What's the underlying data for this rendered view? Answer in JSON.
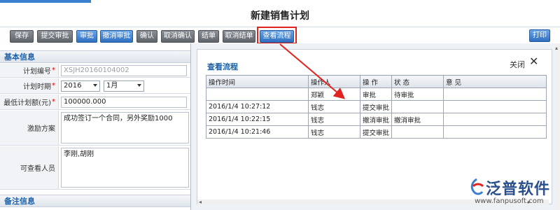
{
  "page_title": "新建销售计划",
  "toolbar": {
    "buttons": [
      {
        "label": "保存",
        "style": "gray"
      },
      {
        "label": "提交审批",
        "style": "gray"
      },
      {
        "label": "审批",
        "style": "blue"
      },
      {
        "label": "撤消审批",
        "style": "blue"
      },
      {
        "label": "确认",
        "style": "gray"
      },
      {
        "label": "取消确认",
        "style": "gray"
      },
      {
        "label": "结单",
        "style": "gray"
      },
      {
        "label": "取消结单",
        "style": "gray"
      },
      {
        "label": "查看流程",
        "style": "blue"
      }
    ],
    "print_label": "打印"
  },
  "basic_info": {
    "section_title": "基本信息",
    "plan_number_label": "计划编号",
    "plan_number_value": "XSJH20160104002",
    "plan_period_label": "计划时期",
    "year_value": "2016",
    "month_value": "1月",
    "min_amount_label": "最低计划额(元)",
    "min_amount_value": "100000.000",
    "incentive_label": "激励方案",
    "incentive_value": "成功签订一个合同，另外奖励1000",
    "viewers_label": "可查看人员",
    "viewers_value": "李刚,胡刚"
  },
  "notes_section_title": "备注信息",
  "modal": {
    "title": "查看流程",
    "close_label": "关闭",
    "columns": [
      "操作时间",
      "操作人",
      "操 作",
      "状 态",
      "意 见"
    ],
    "rows": [
      [
        "",
        "郑颖",
        "审批",
        "待审批",
        ""
      ],
      [
        "2016/1/4 10:27:12",
        "钱志",
        "提交审批",
        "",
        ""
      ],
      [
        "2016/1/4 10:22:15",
        "钱志",
        "撤消审批",
        "撤消审批",
        ""
      ],
      [
        "2016/1/4 10:21:46",
        "钱志",
        "提交审批",
        "",
        ""
      ]
    ]
  },
  "logo": {
    "name": "泛普软件",
    "url": "www.fanpusoft.com"
  },
  "colors": {
    "accent_blue": "#2f6fc1",
    "highlight_red": "#e0231e",
    "title_blue": "#1c5fa6"
  }
}
